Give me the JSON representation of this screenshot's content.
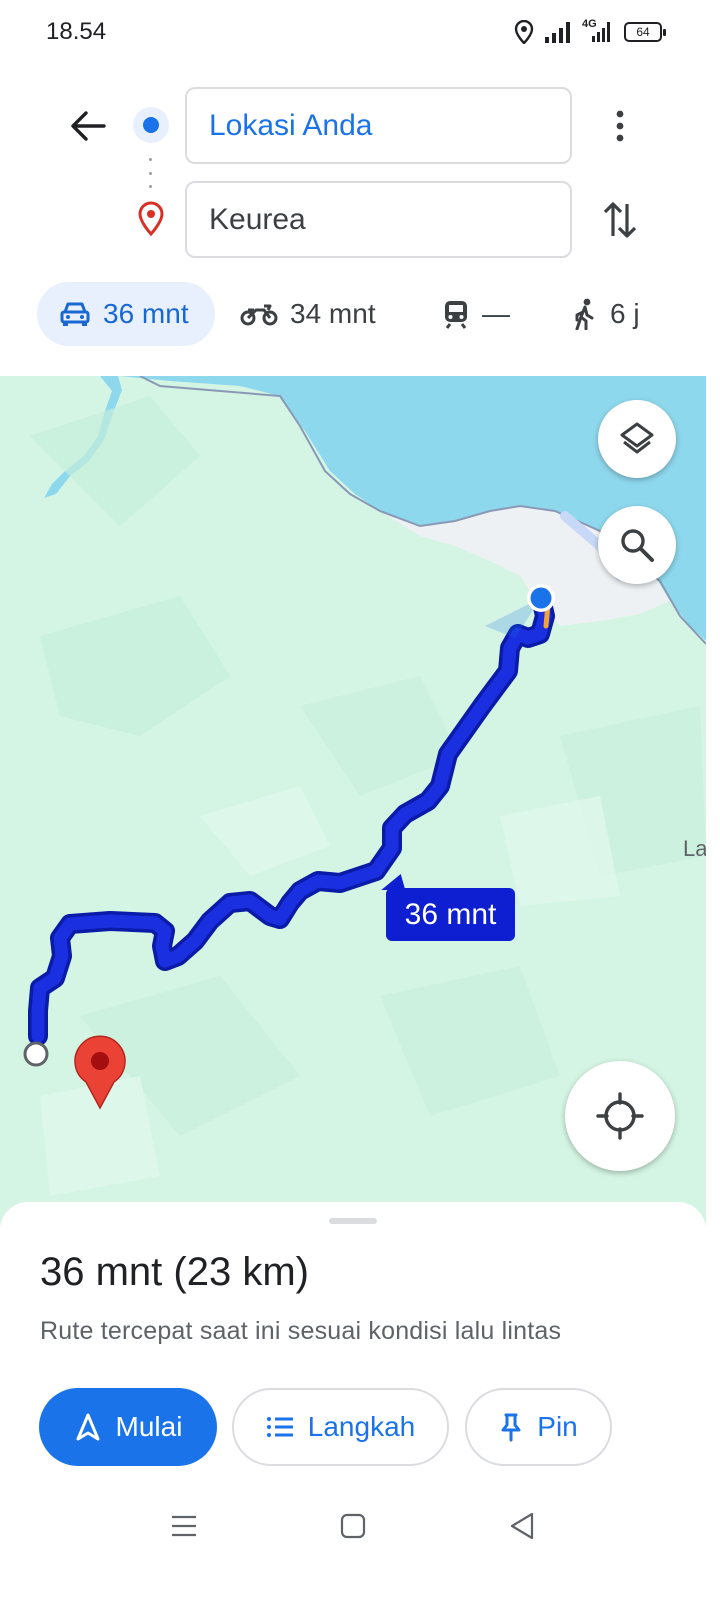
{
  "status_bar": {
    "time": "18.54",
    "network": "4G",
    "battery": "64",
    "icons": [
      "location-icon",
      "signal-icon",
      "4g-signal-icon",
      "battery-icon"
    ]
  },
  "directions": {
    "origin": "Lokasi Anda",
    "destination": "Keurea"
  },
  "travel_modes": [
    {
      "mode": "car",
      "label": "36 mnt",
      "selected": true
    },
    {
      "mode": "motorcycle",
      "label": "34 mnt",
      "selected": false
    },
    {
      "mode": "transit",
      "label": "—",
      "selected": false
    },
    {
      "mode": "walk",
      "label": "6 j",
      "selected": false
    }
  ],
  "map": {
    "route_label": "36 mnt",
    "place_label": "La",
    "colors": {
      "land": "#d4f5e3",
      "water": "#8ed8ed",
      "route": "#1a2fe0",
      "route_label_bg": "#0d1fd1",
      "destination_pin": "#ea4335"
    }
  },
  "summary": {
    "duration_distance": "36 mnt (23 km)",
    "note": "Rute tercepat saat ini sesuai kondisi lalu lintas"
  },
  "actions": {
    "start": "Mulai",
    "steps": "Langkah",
    "pin": "Pin"
  },
  "accent_color": "#1a73e8"
}
